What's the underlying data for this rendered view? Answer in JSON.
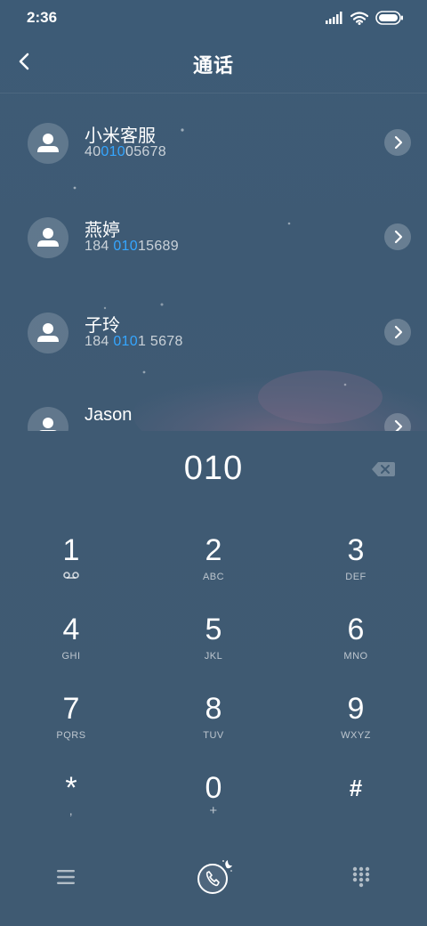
{
  "status_bar": {
    "time": "2:36",
    "icons": [
      "signal-icon",
      "wifi-icon",
      "battery-icon"
    ]
  },
  "header": {
    "title": "通话",
    "back_icon": "back-arrow-icon"
  },
  "contacts": [
    {
      "name": "小米客服",
      "number_pre": "40",
      "number_match": "010",
      "number_post": "05678"
    },
    {
      "name": "燕婷",
      "number_pre": "184 ",
      "number_match": "010",
      "number_post": "15689"
    },
    {
      "name": "子玲",
      "number_pre": "184 ",
      "number_match": "010",
      "number_post": "1 5678"
    },
    {
      "name": "Jason",
      "number_pre": "",
      "number_match": "",
      "number_post": ""
    }
  ],
  "dialer": {
    "input": "010",
    "keys": [
      {
        "digit": "1",
        "letters": ""
      },
      {
        "digit": "2",
        "letters": "ABC"
      },
      {
        "digit": "3",
        "letters": "DEF"
      },
      {
        "digit": "4",
        "letters": "GHI"
      },
      {
        "digit": "5",
        "letters": "JKL"
      },
      {
        "digit": "6",
        "letters": "MNO"
      },
      {
        "digit": "7",
        "letters": "PQRS"
      },
      {
        "digit": "8",
        "letters": "TUV"
      },
      {
        "digit": "9",
        "letters": "WXYZ"
      },
      {
        "digit": "*",
        "letters": ","
      },
      {
        "digit": "0",
        "letters": "+"
      },
      {
        "digit": "#",
        "letters": ""
      }
    ]
  },
  "bottom_bar": {
    "icons": [
      "menu-icon",
      "call-icon",
      "dialpad-icon"
    ]
  },
  "colors": {
    "background": "#3f5a73",
    "match_highlight": "#35a6ff",
    "text": "#ffffff"
  }
}
